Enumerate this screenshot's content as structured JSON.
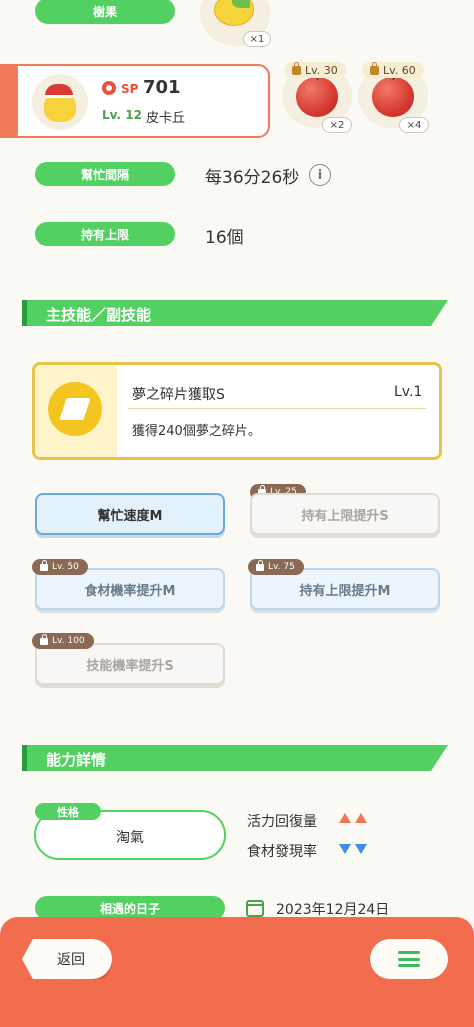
{
  "top": {
    "berry_label": "樹果",
    "berry_count": "×1"
  },
  "ingredients": [
    {
      "level": "Lv. 30",
      "count": "×2"
    },
    {
      "level": "Lv. 60",
      "count": "×4"
    }
  ],
  "pokemon": {
    "sp_label": "SP",
    "sp_value": "701",
    "level": "Lv. 12",
    "name": "皮卡丘"
  },
  "stats": {
    "interval_label": "幫忙間隔",
    "interval_value": "每36分26秒",
    "info_icon": "i",
    "capacity_label": "持有上限",
    "capacity_value": "16個"
  },
  "skills_section": {
    "title": "主技能／副技能",
    "main_skill": {
      "name": "夢之碎片獲取S",
      "level": "Lv.1",
      "desc": "獲得240個夢之碎片。"
    },
    "sub_skills": [
      {
        "label": "幫忙速度M",
        "lock": ""
      },
      {
        "label": "持有上限提升S",
        "lock": "Lv. 25"
      },
      {
        "label": "食材機率提升M",
        "lock": "Lv. 50"
      },
      {
        "label": "持有上限提升M",
        "lock": "Lv. 75"
      },
      {
        "label": "技能機率提升S",
        "lock": "Lv. 100"
      }
    ]
  },
  "ability_section": {
    "title": "能力詳情",
    "nature_label": "性格",
    "nature_value": "淘氣",
    "energy_label": "活力回復量",
    "ingredient_find_label": "食材發現率",
    "meet_date_label": "相遇的日子",
    "meet_date_value": "2023年12月24日"
  },
  "footer": {
    "back_label": "返回",
    "menu_icon": "menu-icon"
  },
  "colors": {
    "green": "#52d162",
    "coral": "#f26d4d",
    "gold": "#e8c34a",
    "up": "#ee7a55",
    "down": "#3e8ee0"
  }
}
